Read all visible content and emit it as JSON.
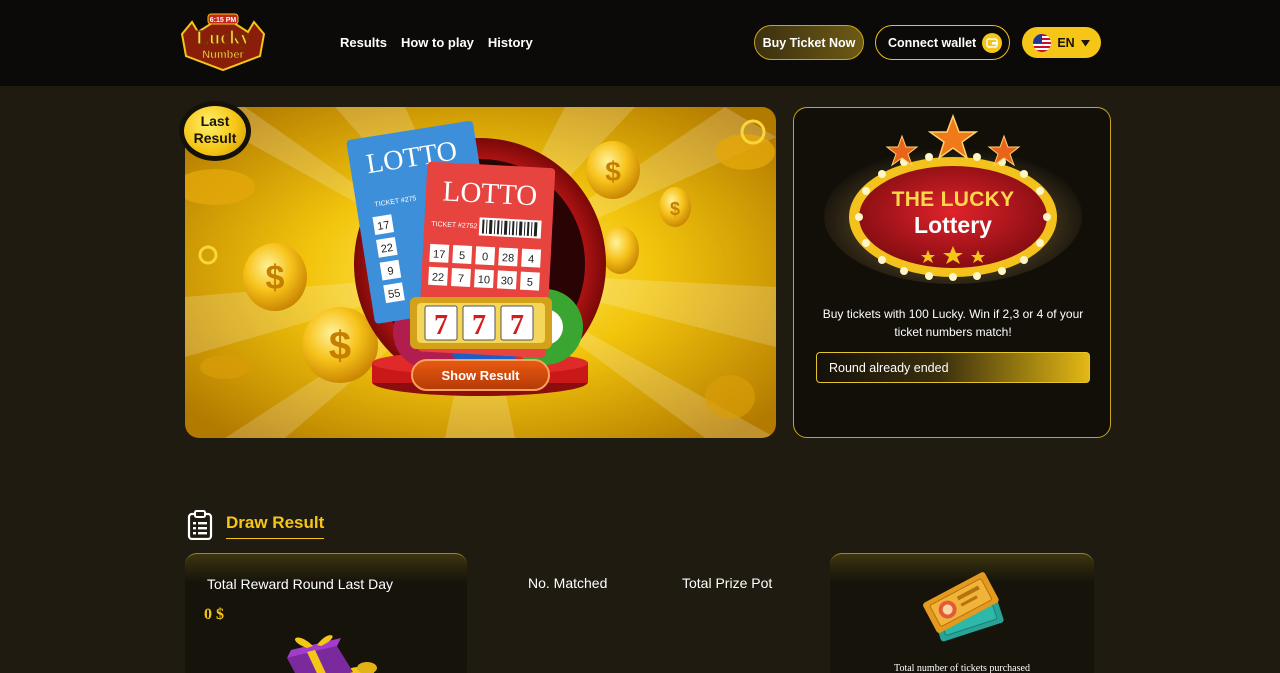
{
  "header": {
    "logo_top_text": "6:15 PM",
    "logo_text_line1": "Lucky",
    "logo_text_line2": "Number",
    "nav": [
      "Results",
      "How to play",
      "History"
    ],
    "buy_ticket_label": "Buy Ticket Now",
    "connect_wallet_label": "Connect wallet",
    "language_label": "EN"
  },
  "hero": {
    "badge_line1": "Last",
    "badge_line2": "Result",
    "ticket_back_title": "LOTTO",
    "ticket_front_title": "LOTTO",
    "ticket_number_label": "TICKET #2752",
    "ticket_back_number_label": "TICKET #275",
    "ticket_grid": [
      "17",
      "5",
      "0",
      "28",
      "4",
      "22",
      "7",
      "10",
      "30",
      "5"
    ],
    "back_grid": [
      "17",
      "22",
      "9",
      "55"
    ],
    "slot_digits": [
      "7",
      "7",
      "7"
    ],
    "show_result_label": "Show Result"
  },
  "lottery_panel": {
    "sign_line1": "THE LUCKY",
    "sign_line2": "Lottery",
    "description": "Buy tickets with 100 Lucky. Win if 2,3 or 4 of your ticket numbers match!",
    "round_status": "Round already ended"
  },
  "draw_result": {
    "title": "Draw Result",
    "total_reward_label": "Total Reward Round Last Day",
    "total_reward_value": "0 $",
    "col_matched": "No. Matched",
    "col_prize_pot": "Total Prize Pot",
    "tickets_purchased_label": "Total number of tickets purchased"
  },
  "colors": {
    "accent": "#f5c518",
    "background": "#201b11",
    "header": "#0c0a08",
    "button_orange": "#d04d0c"
  },
  "icons": [
    "wallet-icon",
    "us-flag-icon",
    "caret-down-icon",
    "clipboard-icon",
    "gift-icon",
    "tickets-icon"
  ]
}
